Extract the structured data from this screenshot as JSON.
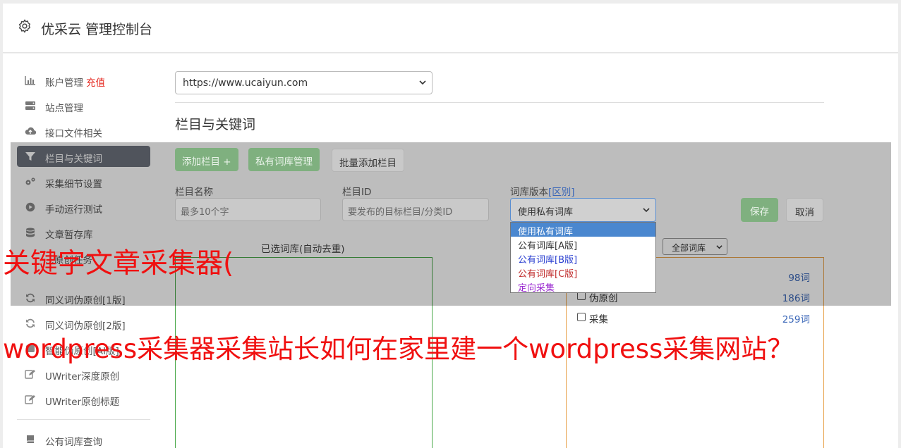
{
  "header": {
    "title": "优采云 管理控制台",
    "icon": "gear-icon"
  },
  "sidebar": {
    "items": [
      {
        "label": "账户管理",
        "extra": "充值",
        "icon": "bar-chart-icon"
      },
      {
        "label": "站点管理",
        "icon": "server-icon"
      },
      {
        "label": "接口文件相关",
        "icon": "cloud-upload-icon"
      },
      {
        "label": "栏目与关键词",
        "icon": "filter-icon",
        "active": true
      },
      {
        "label": "采集细节设置",
        "icon": "gears-icon"
      },
      {
        "label": "手动运行测试",
        "icon": "play-circle-icon"
      },
      {
        "label": "文章暂存库",
        "icon": "database-icon"
      },
      {
        "label": "...原创任务",
        "icon": "task-icon"
      },
      {
        "label": "同义词伪原创[1版]",
        "icon": "refresh-icon"
      },
      {
        "label": "同义词伪原创[2版]",
        "icon": "refresh-icon"
      },
      {
        "label": "智能伪原创[AI版]",
        "icon": "ai-icon"
      },
      {
        "label": "UWriter深度原创",
        "icon": "edit-icon"
      },
      {
        "label": "UWriter原创标题",
        "icon": "edit-icon"
      },
      {
        "label": "公有词库查询",
        "icon": "book-icon"
      }
    ]
  },
  "main": {
    "site_select": "https://www.ucaiyun.com",
    "section_title": "栏目与关键词",
    "buttons": {
      "add_column": "添加栏目 +",
      "private_lib": "私有词库管理",
      "batch_add": "批量添加栏目",
      "save": "保存",
      "cancel": "取消"
    },
    "form": {
      "name_label": "栏目名称",
      "name_placeholder": "最多10个字",
      "id_label": "栏目ID",
      "id_placeholder": "要发布的目标栏目/分类ID",
      "version_label": "词库版本",
      "version_diff": "[区别]",
      "version_selected": "使用私有词库"
    },
    "dropdown_options": [
      {
        "label": "使用私有词库",
        "color": "#ffffff",
        "selected": true
      },
      {
        "label": "公有词库[A版]",
        "color": "#333333"
      },
      {
        "label": "公有词库[B版]",
        "color": "#2a3fd0"
      },
      {
        "label": "公有词库[C版]",
        "color": "#c02a2a"
      },
      {
        "label": "定向采集",
        "color": "#9a2ad0"
      }
    ],
    "selected_lib_label": "已选词库(自动去重)",
    "lib_filter": "全部词库",
    "lib_rows": [
      {
        "name": "",
        "count": "98词"
      },
      {
        "name": "伪原创",
        "count": "186词"
      },
      {
        "name": "采集",
        "count": "259词"
      }
    ]
  },
  "watermark": {
    "line1": "关键字文章采集器(",
    "line2": "wordpress采集器采集站长如何在家里建一个wordpress采集网站？"
  },
  "colors": {
    "accent_green": "#7fb07f",
    "link_blue": "#3b67b8",
    "recharge_red": "#e5261d",
    "watermark_red": "#f01010"
  }
}
